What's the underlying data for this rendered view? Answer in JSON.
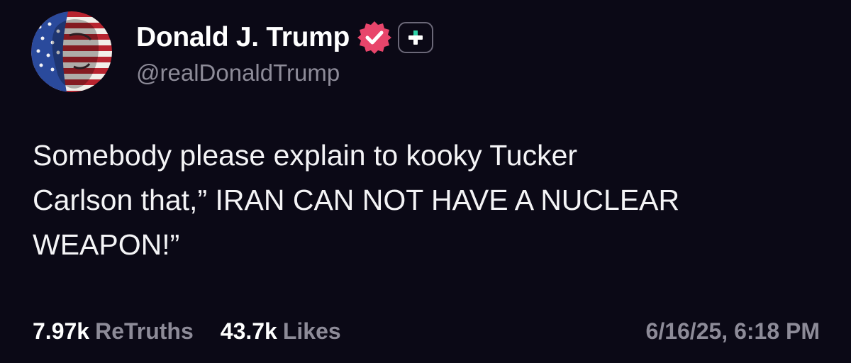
{
  "author": {
    "display_name": "Donald J. Trump",
    "handle": "@realDonaldTrump",
    "avatar_icon": "flag-face-avatar",
    "verified_icon": "verified-badge-icon",
    "plus_icon": "plus-icon"
  },
  "post": {
    "text": "Somebody please explain to kooky Tucker\nCarlson that,” IRAN CAN NOT HAVE A NUCLEAR\nWEAPON!”"
  },
  "stats": {
    "retruths_count": "7.97k",
    "retruths_label": "ReTruths",
    "likes_count": "43.7k",
    "likes_label": "Likes"
  },
  "timestamp": "6/16/25, 6:18 PM",
  "colors": {
    "background": "#0b0916",
    "verified": "#e8456b",
    "plus_accent": "#2fd3a8",
    "muted_text": "#8d8b98"
  }
}
